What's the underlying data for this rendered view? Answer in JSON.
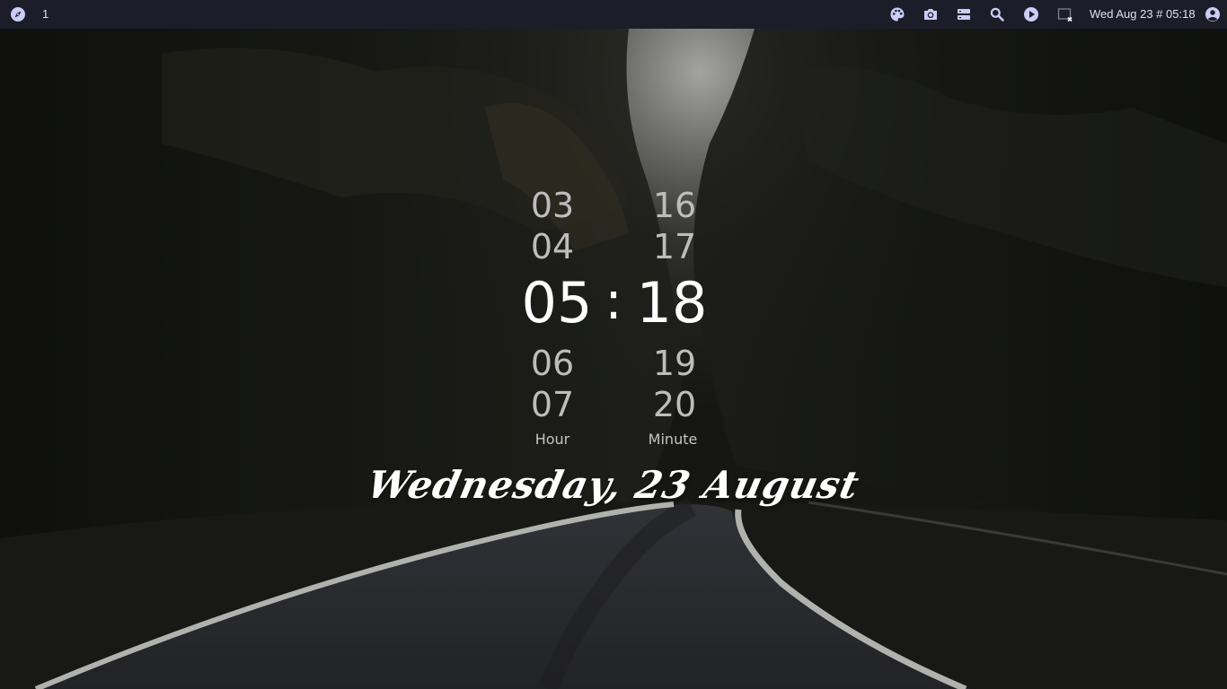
{
  "topbar": {
    "workspace": "1",
    "datetime": "Wed Aug 23 # 05:18",
    "icons": {
      "launcher": "compass-icon",
      "theme": "palette-icon",
      "screenshot": "camera-icon",
      "layout": "layout-icon",
      "search": "search-icon",
      "media": "play-icon",
      "window": "window-close-icon",
      "user": "user-icon"
    },
    "accent": "#c9cdf5"
  },
  "clock": {
    "hours": [
      "03",
      "04",
      "05",
      "06",
      "07"
    ],
    "minutes": [
      "16",
      "17",
      "18",
      "19",
      "20"
    ],
    "separator": ":",
    "hour_label": "Hour",
    "minute_label": "Minute"
  },
  "date_line": "Wednesday, 23 August"
}
